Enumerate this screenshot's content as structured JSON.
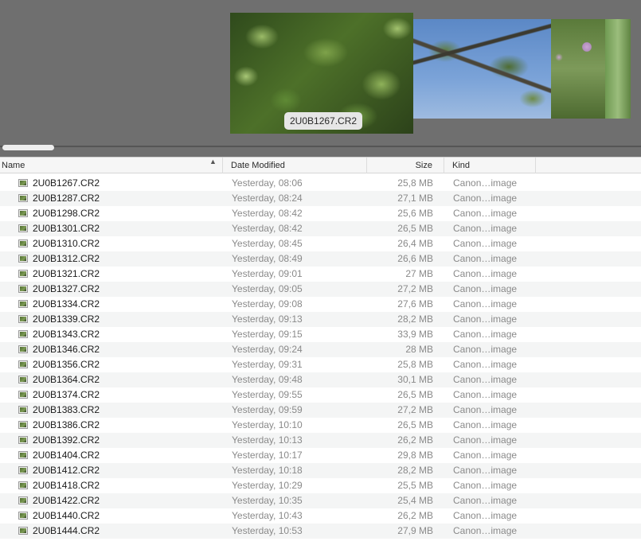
{
  "coverflow": {
    "caption": "2U0B1267.CR2"
  },
  "columns": {
    "name": "Name",
    "date": "Date Modified",
    "size": "Size",
    "kind": "Kind",
    "sort_indicator": "▲"
  },
  "files": [
    {
      "name": "2U0B1267.CR2",
      "date": "Yesterday, 08:06",
      "size": "25,8 MB",
      "kind": "Canon…image"
    },
    {
      "name": "2U0B1287.CR2",
      "date": "Yesterday, 08:24",
      "size": "27,1 MB",
      "kind": "Canon…image"
    },
    {
      "name": "2U0B1298.CR2",
      "date": "Yesterday, 08:42",
      "size": "25,6 MB",
      "kind": "Canon…image"
    },
    {
      "name": "2U0B1301.CR2",
      "date": "Yesterday, 08:42",
      "size": "26,5 MB",
      "kind": "Canon…image"
    },
    {
      "name": "2U0B1310.CR2",
      "date": "Yesterday, 08:45",
      "size": "26,4 MB",
      "kind": "Canon…image"
    },
    {
      "name": "2U0B1312.CR2",
      "date": "Yesterday, 08:49",
      "size": "26,6 MB",
      "kind": "Canon…image"
    },
    {
      "name": "2U0B1321.CR2",
      "date": "Yesterday, 09:01",
      "size": "27 MB",
      "kind": "Canon…image"
    },
    {
      "name": "2U0B1327.CR2",
      "date": "Yesterday, 09:05",
      "size": "27,2 MB",
      "kind": "Canon…image"
    },
    {
      "name": "2U0B1334.CR2",
      "date": "Yesterday, 09:08",
      "size": "27,6 MB",
      "kind": "Canon…image"
    },
    {
      "name": "2U0B1339.CR2",
      "date": "Yesterday, 09:13",
      "size": "28,2 MB",
      "kind": "Canon…image"
    },
    {
      "name": "2U0B1343.CR2",
      "date": "Yesterday, 09:15",
      "size": "33,9 MB",
      "kind": "Canon…image"
    },
    {
      "name": "2U0B1346.CR2",
      "date": "Yesterday, 09:24",
      "size": "28 MB",
      "kind": "Canon…image"
    },
    {
      "name": "2U0B1356.CR2",
      "date": "Yesterday, 09:31",
      "size": "25,8 MB",
      "kind": "Canon…image"
    },
    {
      "name": "2U0B1364.CR2",
      "date": "Yesterday, 09:48",
      "size": "30,1 MB",
      "kind": "Canon…image"
    },
    {
      "name": "2U0B1374.CR2",
      "date": "Yesterday, 09:55",
      "size": "26,5 MB",
      "kind": "Canon…image"
    },
    {
      "name": "2U0B1383.CR2",
      "date": "Yesterday, 09:59",
      "size": "27,2 MB",
      "kind": "Canon…image"
    },
    {
      "name": "2U0B1386.CR2",
      "date": "Yesterday, 10:10",
      "size": "26,5 MB",
      "kind": "Canon…image"
    },
    {
      "name": "2U0B1392.CR2",
      "date": "Yesterday, 10:13",
      "size": "26,2 MB",
      "kind": "Canon…image"
    },
    {
      "name": "2U0B1404.CR2",
      "date": "Yesterday, 10:17",
      "size": "29,8 MB",
      "kind": "Canon…image"
    },
    {
      "name": "2U0B1412.CR2",
      "date": "Yesterday, 10:18",
      "size": "28,2 MB",
      "kind": "Canon…image"
    },
    {
      "name": "2U0B1418.CR2",
      "date": "Yesterday, 10:29",
      "size": "25,5 MB",
      "kind": "Canon…image"
    },
    {
      "name": "2U0B1422.CR2",
      "date": "Yesterday, 10:35",
      "size": "25,4 MB",
      "kind": "Canon…image"
    },
    {
      "name": "2U0B1440.CR2",
      "date": "Yesterday, 10:43",
      "size": "26,2 MB",
      "kind": "Canon…image"
    },
    {
      "name": "2U0B1444.CR2",
      "date": "Yesterday, 10:53",
      "size": "27,9 MB",
      "kind": "Canon…image"
    }
  ],
  "colors": {
    "coverflow_background": "#6f6f6f",
    "secondary_text": "#8a8a8a",
    "stripe": "#f4f5f5"
  }
}
